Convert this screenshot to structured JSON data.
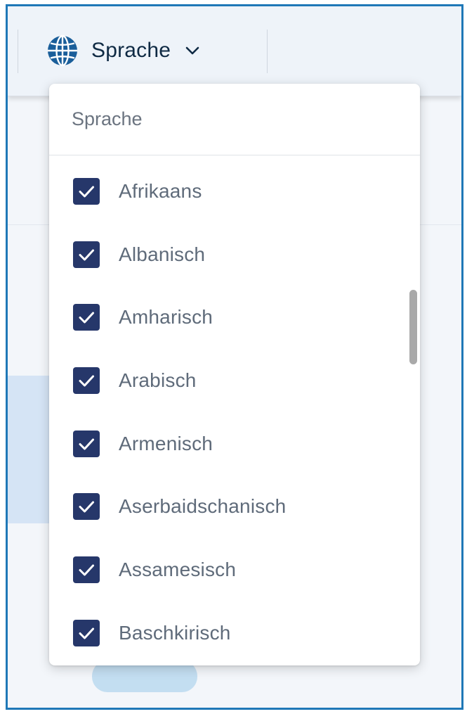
{
  "header": {
    "language_button_label": "Sprache",
    "globe_icon": "globe-icon",
    "chevron_icon": "chevron-down-icon"
  },
  "dropdown": {
    "title": "Sprache",
    "options": [
      {
        "label": "Afrikaans",
        "checked": true
      },
      {
        "label": "Albanisch",
        "checked": true
      },
      {
        "label": "Amharisch",
        "checked": true
      },
      {
        "label": "Arabisch",
        "checked": true
      },
      {
        "label": "Armenisch",
        "checked": true
      },
      {
        "label": "Aserbaidschanisch",
        "checked": true
      },
      {
        "label": "Assamesisch",
        "checked": true
      },
      {
        "label": "Baschkirisch",
        "checked": true
      }
    ]
  },
  "colors": {
    "frame_border": "#1f78b7",
    "checkbox_fill": "#26376a",
    "globe": "#1a5e9a",
    "text_dark": "#0f2a44",
    "text_muted": "#5f6b7a"
  }
}
